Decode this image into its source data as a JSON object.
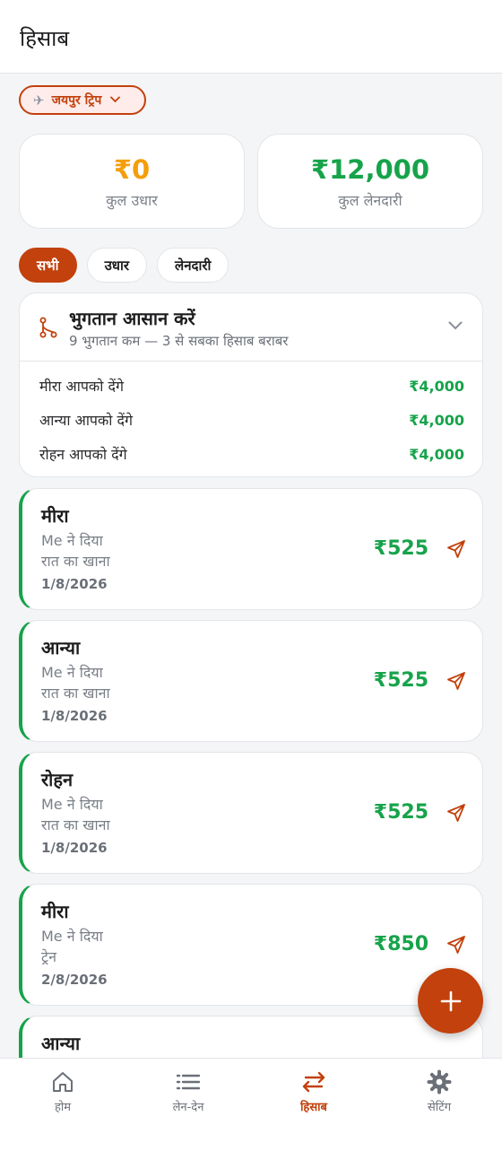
{
  "header": {
    "title": "हिसाब"
  },
  "trip": {
    "name": "जयपुर ट्रिप",
    "icon": "plane-icon"
  },
  "summary": {
    "owe": {
      "amount": "₹0",
      "label": "कुल उधार",
      "color": "#f59e0b"
    },
    "receive": {
      "amount": "₹12,000",
      "label": "कुल लेनदारी",
      "color": "#16a34a"
    }
  },
  "filters": [
    {
      "label": "सभी",
      "active": true
    },
    {
      "label": "उधार",
      "active": false
    },
    {
      "label": "लेनदारी",
      "active": false
    }
  ],
  "settle": {
    "title": "भुगतान आसान करें",
    "subtitle": "9 भुगतान कम — 3 से सबका हिसाब बराबर",
    "rows": [
      {
        "who": "मीरा आपको देंगे",
        "amount": "₹4,000"
      },
      {
        "who": "आन्या आपको देंगे",
        "amount": "₹4,000"
      },
      {
        "who": "रोहन आपको देंगे",
        "amount": "₹4,000"
      }
    ]
  },
  "transactions": [
    {
      "name": "मीरा",
      "payer": "Me ने दिया",
      "desc": "रात का खाना",
      "date": "1/8/2026",
      "amount": "₹525"
    },
    {
      "name": "आन्या",
      "payer": "Me ने दिया",
      "desc": "रात का खाना",
      "date": "1/8/2026",
      "amount": "₹525"
    },
    {
      "name": "रोहन",
      "payer": "Me ने दिया",
      "desc": "रात का खाना",
      "date": "1/8/2026",
      "amount": "₹525"
    },
    {
      "name": "मीरा",
      "payer": "Me ने दिया",
      "desc": "ट्रेन",
      "date": "2/8/2026",
      "amount": "₹850"
    },
    {
      "name": "आन्या",
      "payer": "",
      "desc": "",
      "date": "",
      "amount": ""
    }
  ],
  "nav": [
    {
      "label": "होम",
      "icon": "home-icon",
      "active": false
    },
    {
      "label": "लेन-देन",
      "icon": "list-icon",
      "active": false
    },
    {
      "label": "हिसाब",
      "icon": "swap-arrows-icon",
      "active": true
    },
    {
      "label": "सेटिंग",
      "icon": "gear-icon",
      "active": false
    }
  ],
  "colors": {
    "accent": "#c2410c",
    "positive": "#16a34a",
    "warning": "#f59e0b"
  }
}
